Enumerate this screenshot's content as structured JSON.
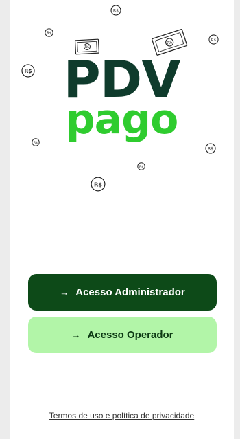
{
  "logo": {
    "line1": "PDV",
    "line2": "pago"
  },
  "buttons": {
    "admin_arrow": "→",
    "admin_label": "Acesso Administrador",
    "operator_arrow": "→",
    "operator_label": "Acesso Operador"
  },
  "footer": {
    "terms_link": "Termos de uso e política de privacidade"
  },
  "decorations": {
    "coin_label": "R$",
    "icon": "money-icon"
  },
  "colors": {
    "logo_dark": "#0f3b2c",
    "logo_green": "#2fcc2f",
    "admin_button": "#0d4a18",
    "operator_button": "#b2f5a8"
  }
}
